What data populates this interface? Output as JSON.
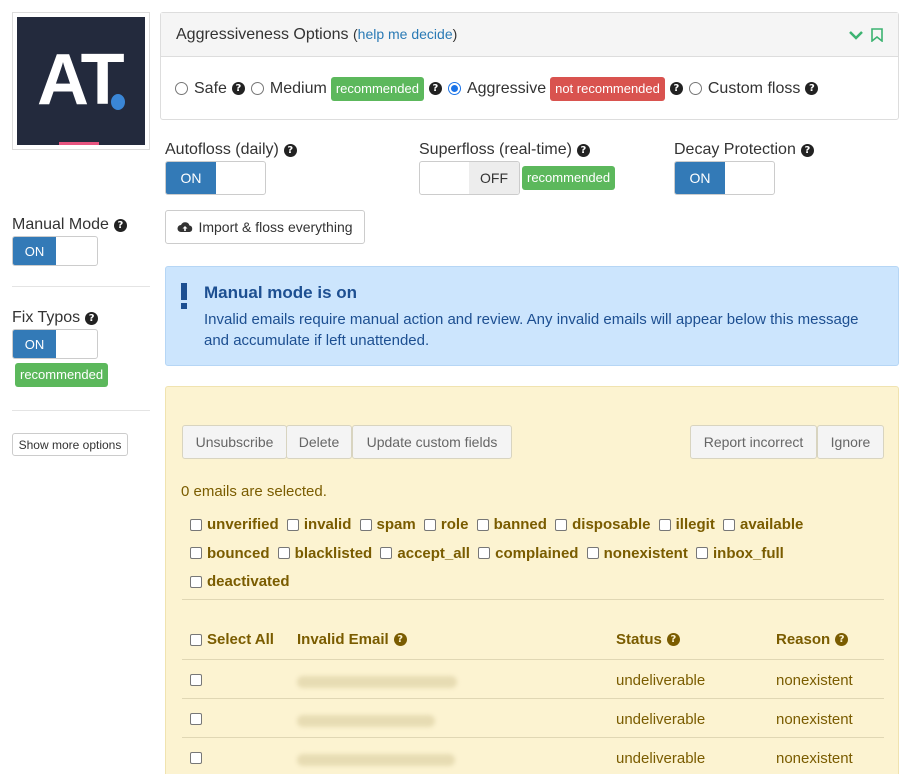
{
  "logo": {
    "text": "AT"
  },
  "aggressiveness": {
    "title": "Aggressiveness Options",
    "help_prefix": "(",
    "help_link": "help me decide",
    "help_suffix": ")",
    "options": [
      {
        "label": "Safe",
        "checked": false
      },
      {
        "label": "Medium",
        "checked": false,
        "badge": "recommended"
      },
      {
        "label": "Aggressive",
        "checked": true,
        "badge": "not recommended"
      },
      {
        "label": "Custom floss",
        "checked": false
      }
    ]
  },
  "toggles": {
    "autofloss": {
      "label": "Autofloss (daily)",
      "state": "ON"
    },
    "superfloss": {
      "label": "Superfloss (real-time)",
      "state": "OFF",
      "badge": "recommended"
    },
    "decay": {
      "label": "Decay Protection",
      "state": "ON"
    },
    "manual": {
      "label": "Manual Mode",
      "state": "ON"
    },
    "typos": {
      "label": "Fix Typos",
      "state": "ON",
      "badge": "recommended"
    }
  },
  "import_button": "Import & floss everything",
  "show_more": "Show more options",
  "alert": {
    "title": "Manual mode is on",
    "text": "Invalid emails require manual action and review. Any invalid emails will appear below this message and accumulate if left unattended."
  },
  "actions": {
    "unsubscribe": "Unsubscribe",
    "delete": "Delete",
    "update": "Update custom fields",
    "report": "Report incorrect",
    "ignore": "Ignore"
  },
  "selected_text": "0 emails are selected.",
  "filters": [
    "unverified",
    "invalid",
    "spam",
    "role",
    "banned",
    "disposable",
    "illegit",
    "available",
    "bounced",
    "blacklisted",
    "accept_all",
    "complained",
    "nonexistent",
    "inbox_full",
    "deactivated"
  ],
  "table": {
    "headers": {
      "select_all": "Select All",
      "email": "Invalid Email",
      "status": "Status",
      "reason": "Reason"
    },
    "rows": [
      {
        "status": "undeliverable",
        "reason": "nonexistent"
      },
      {
        "status": "undeliverable",
        "reason": "nonexistent"
      },
      {
        "status": "undeliverable",
        "reason": "nonexistent"
      }
    ]
  }
}
